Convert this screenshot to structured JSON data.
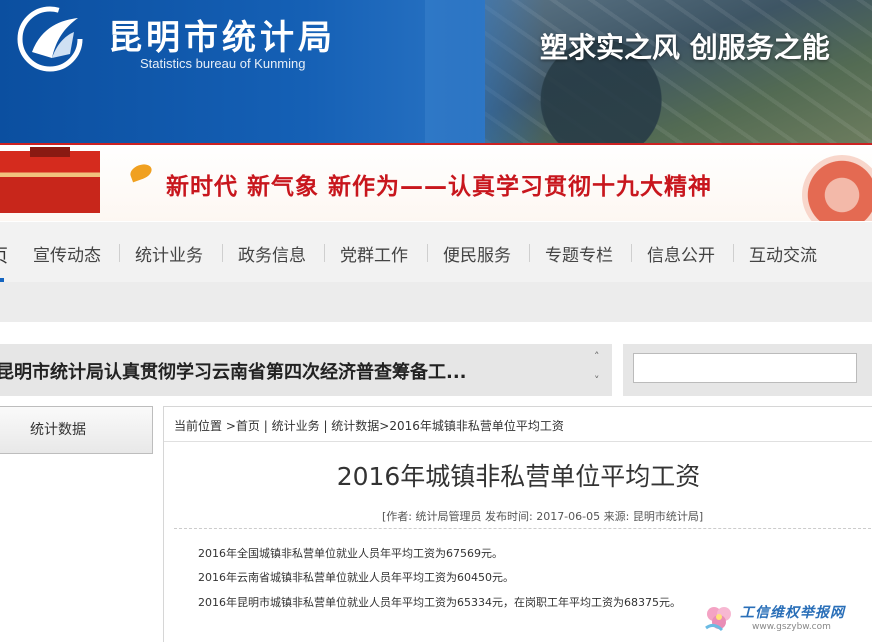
{
  "header": {
    "title": "昆明市统计局",
    "subtitle": "Statistics bureau of Kunming",
    "slogan": "塑求实之风  创服务之能"
  },
  "banner": {
    "text": "新时代  新气象  新作为——认真学习贯彻十九大精神"
  },
  "nav": {
    "active_partial": "页",
    "items": [
      "宣传动态",
      "统计业务",
      "政务信息",
      "党群工作",
      "便民服务",
      "专题专栏",
      "信息公开",
      "互动交流"
    ]
  },
  "ticker": {
    "text": "昆明市统计局认真贯彻学习云南省第四次经济普查筹备工...",
    "up": "˄",
    "down": "˅"
  },
  "search": {
    "value": "",
    "placeholder": ""
  },
  "sidebar": {
    "label": "统计数据"
  },
  "breadcrumb": {
    "prefix": "当前位置",
    "home": ">首页",
    "level1": "统计业务",
    "level2": "统计数据>2016年城镇非私营单位平均工资"
  },
  "article": {
    "title": "2016年城镇非私营单位平均工资",
    "meta": "[作者: 统计局管理员 发布时间: 2017-06-05 来源: 昆明市统计局]",
    "paragraphs": [
      "2016年全国城镇非私营单位就业人员年平均工资为67569元。",
      "2016年云南省城镇非私营单位就业人员年平均工资为60450元。",
      "2016年昆明市城镇非私营单位就业人员年平均工资为65334元，在岗职工年平均工资为68375元。"
    ]
  },
  "watermark": {
    "title": "工信维权举报网",
    "url": "www.gszybw.com"
  }
}
